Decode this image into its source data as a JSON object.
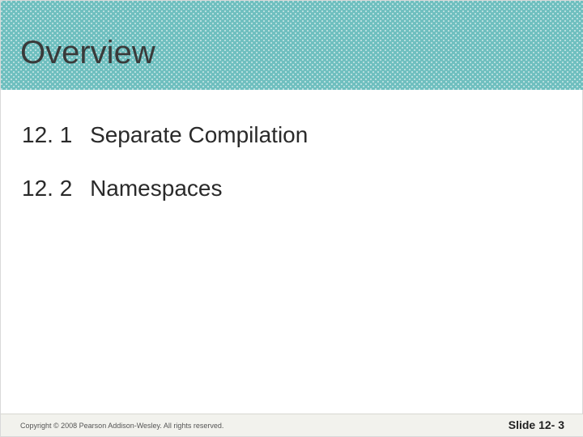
{
  "title": "Overview",
  "items": [
    {
      "num": "12. 1",
      "text": "Separate Compilation"
    },
    {
      "num": "12. 2",
      "text": "Namespaces"
    }
  ],
  "footer": {
    "copyright": "Copyright © 2008 Pearson Addison-Wesley. All rights reserved.",
    "slide_label": "Slide 12- 3"
  }
}
